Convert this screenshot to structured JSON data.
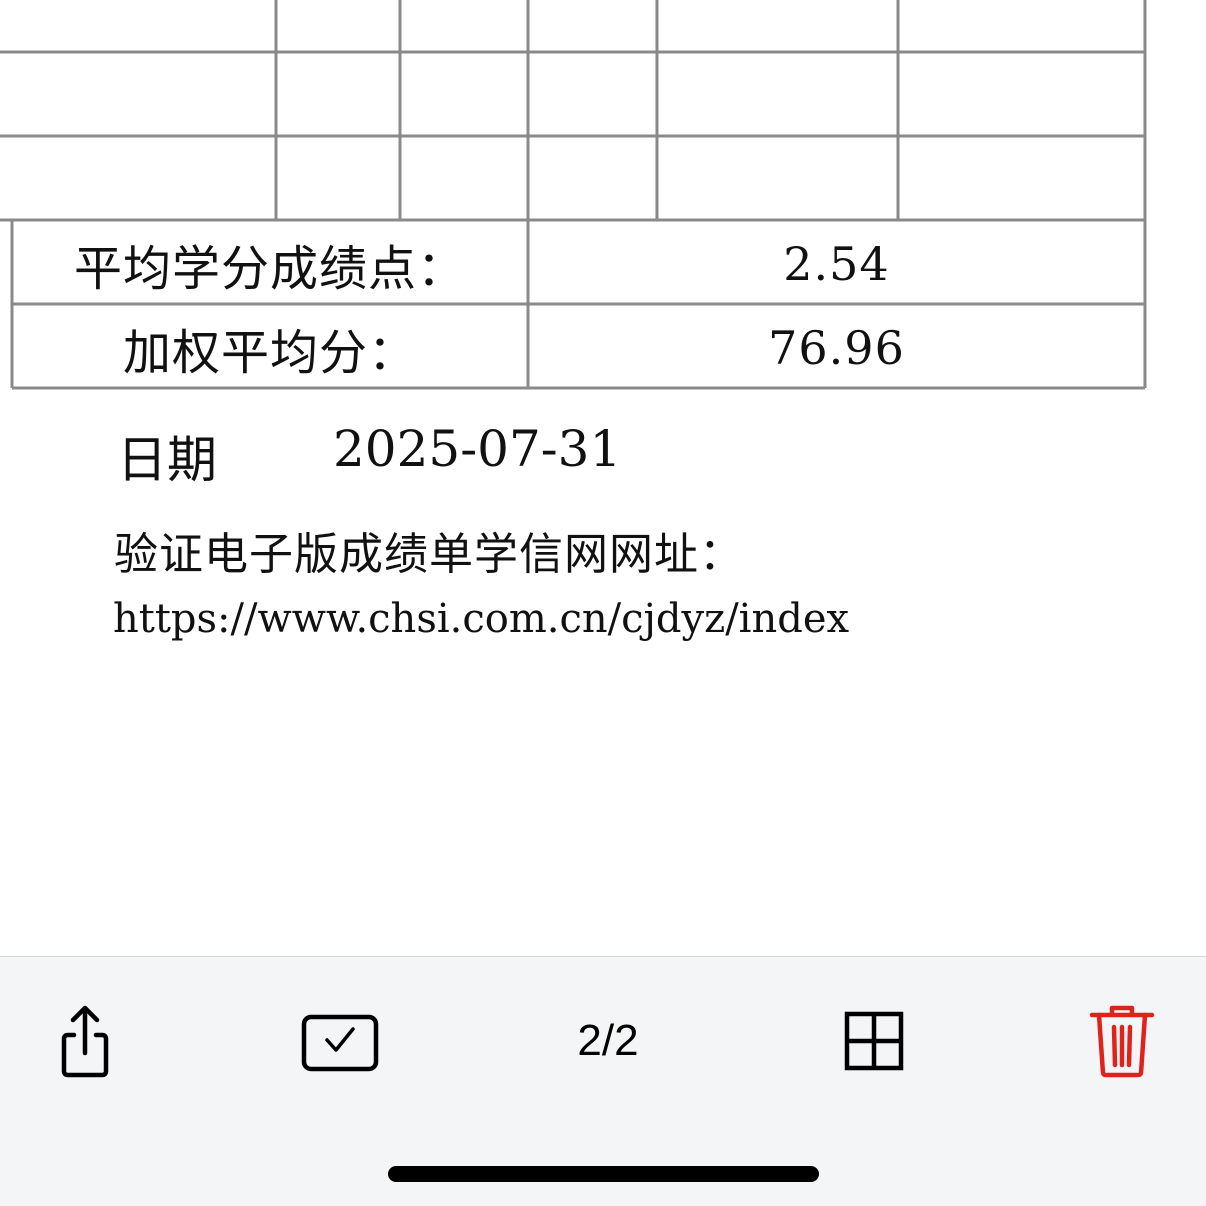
{
  "document": {
    "summary_rows": [
      {
        "label": "平均学分成绩点：",
        "value": "2.54"
      },
      {
        "label": "加权平均分：",
        "value": "76.96"
      }
    ],
    "date_label": "日期",
    "date_value": "2025-07-31",
    "verify_label": "验证电子版成绩单学信网网址：",
    "verify_url": "https://www.chsi.com.cn/cjdyz/index"
  },
  "toolbar": {
    "share_icon": "share-icon",
    "select_icon": "checkbox-select-icon",
    "page_indicator": "2/2",
    "grid_icon": "grid-view-icon",
    "delete_icon": "trash-icon",
    "delete_color": "#e0221c"
  }
}
